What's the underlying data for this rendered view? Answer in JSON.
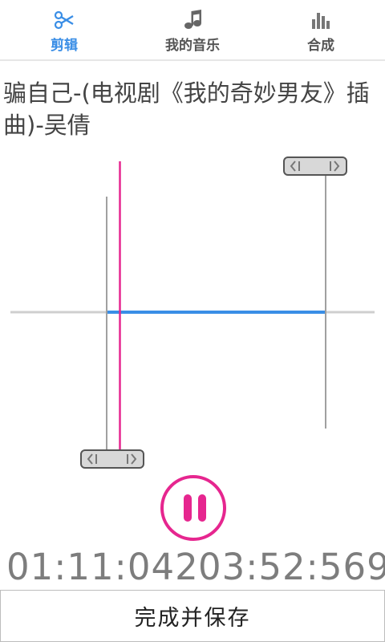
{
  "tabs": [
    {
      "label": "剪辑",
      "icon": "scissors-icon",
      "active": true
    },
    {
      "label": "我的音乐",
      "icon": "music-note-icon",
      "active": false
    },
    {
      "label": "合成",
      "icon": "equalizer-icon",
      "active": false
    }
  ],
  "song_title": "骗自己-(电视剧《我的奇妙男友》插曲)-吴倩",
  "playback": {
    "state": "playing",
    "control_icon": "pause-icon"
  },
  "selection": {
    "start_time": "01:11:042",
    "end_time": "03:52:569"
  },
  "handles": {
    "left_icon": "drag-handle-icon",
    "right_icon": "drag-handle-icon"
  },
  "save_button": {
    "label": "完成并保存"
  },
  "colors": {
    "accent": "#3a8ee6",
    "playhead": "#e6268f",
    "time_text": "#7d7d7d"
  }
}
